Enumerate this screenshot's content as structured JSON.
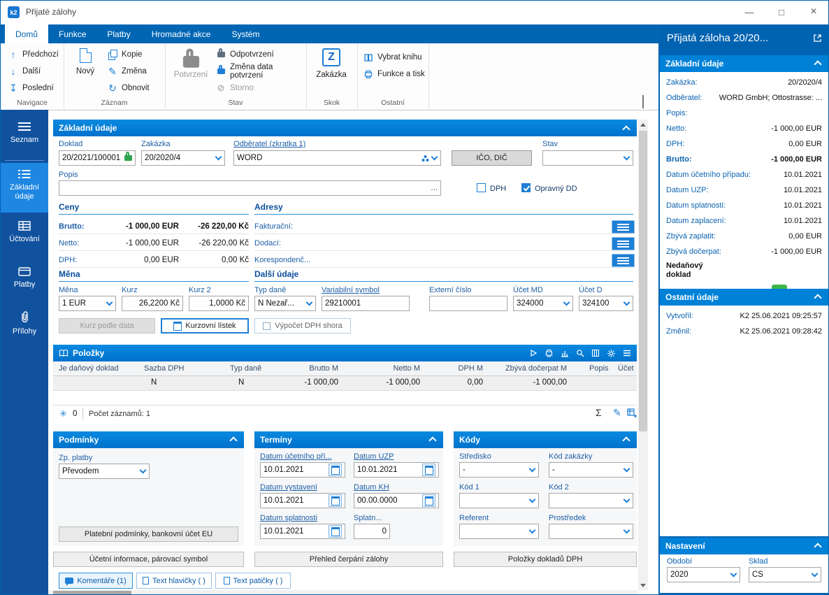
{
  "window": {
    "title": "Přijaté zálohy"
  },
  "icons": {
    "app_logo": "k2",
    "minimize": "—",
    "maximize": "□",
    "close": "×",
    "prev_arrow": "↑",
    "next_arrow": "↓",
    "last_arrow": "↧",
    "refresh": "↻",
    "storno": "⊘",
    "zakazka_letter": "Z",
    "snowflake": "✳",
    "sum": "Σ",
    "edit_pencil": "✎",
    "ellipsis": "..."
  },
  "colors": {
    "accent": "#0063b1",
    "section_header": "#0080d8",
    "sidebar": "#11529f",
    "sidebar_selected": "#1e87e2",
    "confirm_green": "#3db54a"
  },
  "ribbon": {
    "tabs": [
      "Domů",
      "Funkce",
      "Platby",
      "Hromadné akce",
      "Systém"
    ],
    "groups": {
      "navigace": {
        "label": "Navigace",
        "items": [
          "Předchozí",
          "Další",
          "Poslední"
        ]
      },
      "zaznam": {
        "label": "Záznam",
        "big": "Nový",
        "items": [
          "Kopie",
          "Změna",
          "Obnovit"
        ]
      },
      "stav": {
        "label": "Stav",
        "big": "Potvrzení",
        "items": [
          "Odpotvrzení",
          "Změna data potvrzení",
          "Storno"
        ]
      },
      "skok": {
        "label": "Skok",
        "big": "Zakázka"
      },
      "ostatni": {
        "label": "Ostatní",
        "items": [
          "Vybrat knihu",
          "Funkce a tisk"
        ]
      }
    }
  },
  "sidebar": {
    "items": [
      "Seznam",
      "Základní údaje",
      "Účtování",
      "Platby",
      "Přílohy"
    ]
  },
  "main": {
    "section_title": "Základní údaje",
    "fields": {
      "doklad": {
        "label": "Doklad",
        "value": "20/2021/100001"
      },
      "zakazka": {
        "label": "Zakázka",
        "value": "20/2020/4"
      },
      "odberatel": {
        "label": "Odběratel (zkratka 1)",
        "value": "WORD"
      },
      "ico_dic_button": "IČO, DIČ",
      "stav": {
        "label": "Stav",
        "value": ""
      },
      "popis": {
        "label": "Popis",
        "value": ""
      },
      "dph_checkbox": "DPH",
      "opravny_dd_checkbox": "Opravný DD"
    },
    "ceny": {
      "title": "Ceny",
      "rows": [
        {
          "label": "Brutto:",
          "eur": "-1 000,00 EUR",
          "kc": "-26 220,00 Kč"
        },
        {
          "label": "Netto:",
          "eur": "-1 000,00 EUR",
          "kc": "-26 220,00 Kč"
        },
        {
          "label": "DPH:",
          "eur": "0,00 EUR",
          "kc": "0,00 Kč"
        }
      ]
    },
    "adresy": {
      "title": "Adresy",
      "rows": [
        {
          "label": "Fakturační:"
        },
        {
          "label": "Dodací:"
        },
        {
          "label": "Korespondenč..."
        }
      ]
    },
    "mena": {
      "title": "Měna",
      "mena": {
        "label": "Měna",
        "value": "1 EUR"
      },
      "kurz": {
        "label": "Kurz",
        "value": "26,2200 Kč"
      },
      "kurz2": {
        "label": "Kurz 2",
        "value": "1,0000 Kč"
      },
      "kurz_podle_data": "Kurz podle data",
      "kurzovni_listek": "Kurzovní lístek",
      "vypocet_dph": "Výpočet DPH shora"
    },
    "dalsi": {
      "title": "Další údaje",
      "typ_dane": {
        "label": "Typ daně",
        "value": "N Nezař..."
      },
      "var_symbol": {
        "label": "Variabilní symbol",
        "value": "29210001"
      },
      "externi": {
        "label": "Externí číslo",
        "value": ""
      },
      "ucet_md": {
        "label": "Účet MD",
        "value": "324000"
      },
      "ucet_d": {
        "label": "Účet D",
        "value": "324100"
      }
    },
    "polozky": {
      "title": "Položky",
      "columns": [
        "Je daňový doklad",
        "Sazba DPH",
        "Typ daně",
        "Brutto M",
        "Netto M",
        "DPH M",
        "Zbývá dočerpat M",
        "Popis",
        "Účet"
      ],
      "rows": [
        [
          "",
          "N",
          "N",
          "-1 000,00",
          "-1 000,00",
          "0,00",
          "-1 000,00",
          "",
          ""
        ]
      ],
      "footer": {
        "snowflake_count": "0",
        "records": "Počet záznamů: 1"
      }
    },
    "podminky": {
      "title": "Podmínky",
      "zp_platby": {
        "label": "Zp. platby",
        "value": "Převodem"
      },
      "button": "Platební podmínky, bankovní účet EU"
    },
    "terminy": {
      "title": "Termíny",
      "fields": [
        {
          "label": "Datum účetního pří...",
          "value": "10.01.2021"
        },
        {
          "label": "Datum UZP",
          "value": "10.01.2021"
        },
        {
          "label": "Datum vystavení",
          "value": "10.01.2021"
        },
        {
          "label": "Datum KH",
          "value": "00.00.0000"
        },
        {
          "label": "Datum splatnosti",
          "value": "10.01.2021"
        },
        {
          "label": "Splatn...",
          "value": "0"
        }
      ]
    },
    "kody": {
      "title": "Kódy",
      "fields": [
        {
          "label": "Středisko",
          "value": "-"
        },
        {
          "label": "Kód zakázky",
          "value": "-"
        },
        {
          "label": "Kód 1",
          "value": ""
        },
        {
          "label": "Kód 2",
          "value": ""
        },
        {
          "label": "Referent",
          "value": ""
        },
        {
          "label": "Prostředek",
          "value": ""
        }
      ]
    },
    "bottom_buttons": [
      "Účetní informace, párovací symbol",
      "Přehled čerpání zálohy",
      "Položky dokladů DPH"
    ],
    "bottom_tabs": [
      "Komentáře (1)",
      "Text hlavičky ( )",
      "Text patičky ( )"
    ]
  },
  "right_panel": {
    "title": "Přijatá záloha 20/20...",
    "zakladni": {
      "title": "Základní údaje",
      "rows": [
        {
          "label": "Zakázka:",
          "value": "20/2020/4"
        },
        {
          "label": "Odběratel:",
          "value": "WORD GmbH; Ottostrasse: ..."
        },
        {
          "label": "Popis:",
          "value": ""
        },
        {
          "label": "Netto:",
          "value": "-1 000,00 EUR"
        },
        {
          "label": "DPH:",
          "value": "0,00 EUR"
        },
        {
          "label": "Brutto:",
          "value": "-1 000,00 EUR"
        },
        {
          "label": "Datum účetního případu:",
          "value": "10.01.2021"
        },
        {
          "label": "Datum UZP:",
          "value": "10.01.2021"
        },
        {
          "label": "Datum splatnosti:",
          "value": "10.01.2021"
        },
        {
          "label": "Datum zaplacení:",
          "value": "10.01.2021"
        },
        {
          "label": "Zbývá zaplatit:",
          "value": "0,00 EUR"
        },
        {
          "label": "Zbývá dočerpat:",
          "value": "-1 000,00 EUR"
        },
        {
          "label": "Nedaňový doklad",
          "value": ""
        }
      ]
    },
    "ostatni": {
      "title": "Ostatní údaje",
      "rows": [
        {
          "label": "Vytvořil:",
          "value": "K2 25.06.2021 09:25:57"
        },
        {
          "label": "Změnil:",
          "value": "K2 25.06.2021 09:28:42"
        }
      ]
    },
    "nastaveni": {
      "title": "Nastavení",
      "obdobi": {
        "label": "Období",
        "value": "2020"
      },
      "sklad": {
        "label": "Sklad",
        "value": "CS"
      }
    }
  }
}
